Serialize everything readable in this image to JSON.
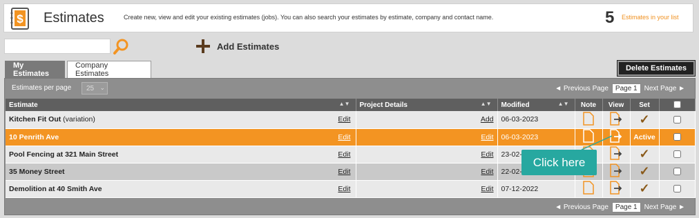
{
  "header": {
    "title": "Estimates",
    "description": "Create new, view and edit your existing estimates (jobs). You can also search your estimates by estimate, company and contact name.",
    "count": "5",
    "count_label": "Estimates in your list",
    "icon": "dollar-document-icon"
  },
  "toolbar": {
    "search_placeholder": "",
    "search_icon": "search-icon",
    "add_icon": "plus-icon",
    "add_label": "Add Estimates"
  },
  "tabs": {
    "my": "My Estimates",
    "company": "Company Estimates"
  },
  "delete_label": "Delete Estimates",
  "pager": {
    "per_page_label": "Estimates per page",
    "per_page_value": "25",
    "prev": "◄ Previous Page",
    "page": "Page 1",
    "next": "Next Page ►"
  },
  "columns": {
    "estimate": "Estimate",
    "project": "Project Details",
    "modified": "Modified",
    "note": "Note",
    "view": "View",
    "set": "Set",
    "sort_glyph": "▲▼"
  },
  "rows": [
    {
      "name": "Kitchen Fit Out",
      "suffix": " (variation)",
      "edit": "Edit",
      "project": "Add",
      "modified": "06-03-2023",
      "set": "✓"
    },
    {
      "name": "10 Penrith Ave",
      "suffix": "",
      "edit": "Edit",
      "project": "Edit",
      "modified": "06-03-2023",
      "set": "Active"
    },
    {
      "name": "Pool Fencing at 321 Main Street",
      "suffix": "",
      "edit": "Edit",
      "project": "Edit",
      "modified": "23-02-",
      "set": "✓"
    },
    {
      "name": "35 Money Street",
      "suffix": "",
      "edit": "Edit",
      "project": "Edit",
      "modified": "22-02-",
      "set": "✓"
    },
    {
      "name": "Demolition at 40 Smith Ave",
      "suffix": "",
      "edit": "Edit",
      "project": "Edit",
      "modified": "07-12-2022",
      "set": "✓"
    }
  ],
  "tooltip": "Click here",
  "colors": {
    "accent": "#f39422",
    "tooltip": "#27a8a0",
    "header_row": "#5f5f5f"
  }
}
